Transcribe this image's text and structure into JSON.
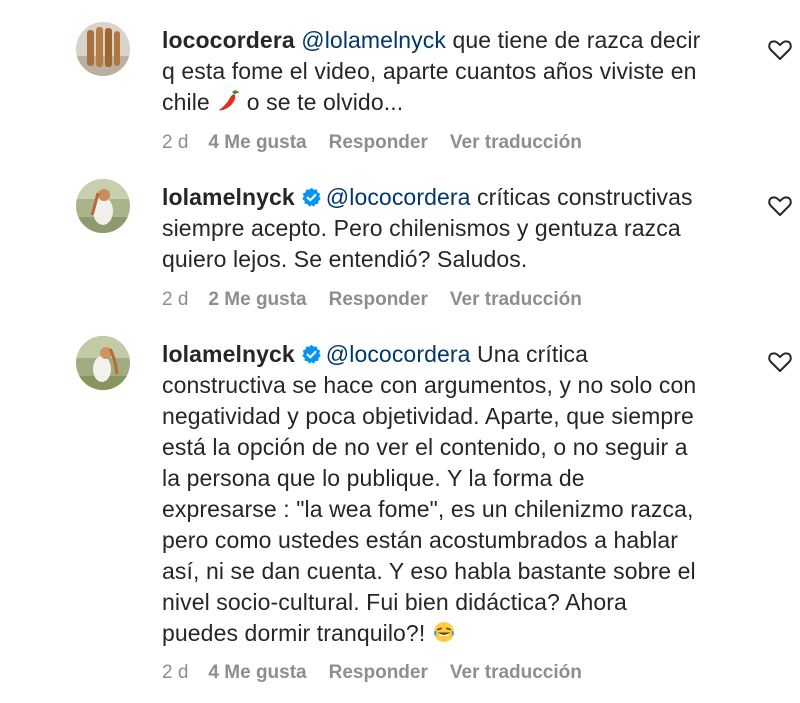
{
  "comments": [
    {
      "username": "lococordera",
      "verified": false,
      "mention": "@lolamelnyck",
      "text1": " que tiene de razca decir",
      "text2": "q esta fome el video, aparte cuantos años viviste en",
      "text3": "chile ",
      "text4": " o se te olvido...",
      "emoji": "chili-pepper",
      "time": "2 d",
      "likes": "4 Me gusta",
      "reply": "Responder",
      "translate": "Ver traducción"
    },
    {
      "username": "lolamelnyck",
      "verified": true,
      "mention": "@lococordera",
      "text1": " críticas constructivas",
      "text2": "siempre acepto. Pero chilenismos y gentuza razca",
      "text3": "quiero lejos. Se entendió? Saludos.",
      "time": "2 d",
      "likes": "2 Me gusta",
      "reply": "Responder",
      "translate": "Ver traducción"
    },
    {
      "username": "lolamelnyck",
      "verified": true,
      "mention": "@lococordera",
      "text1": " Una crítica",
      "lines": [
        "constructiva se hace con argumentos, y no solo con",
        "negatividad y poca objetividad. Aparte, que siempre",
        "está la opción de no ver el contenido, o no seguir a",
        "la persona que lo publique. Y la forma de",
        "expresarse : \"la wea fome\", es un chilenizmo razca,",
        "pero como ustedes están acostumbrados a hablar",
        "así, ni se dan cuenta. Y eso habla bastante sobre el",
        "nivel socio-cultural. Fui bien didáctica? Ahora",
        "puedes dormir tranquilo?! "
      ],
      "emoji": "laughing-tears",
      "time": "2 d",
      "likes": "4 Me gusta",
      "reply": "Responder",
      "translate": "Ver traducción"
    }
  ]
}
